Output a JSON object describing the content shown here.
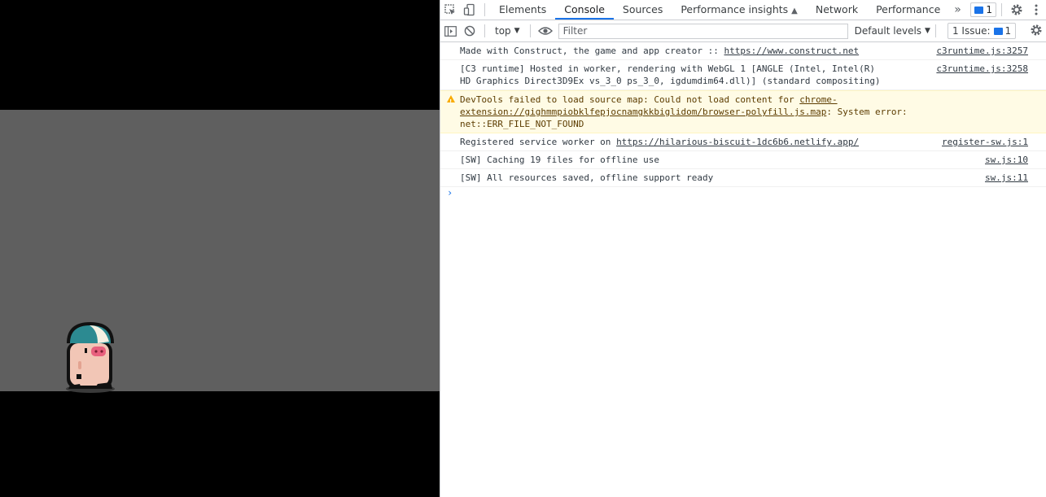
{
  "colors": {
    "canvas_bg": "#5f5f5f",
    "accent": "#1a73e8",
    "warning_bg": "#fffbe5"
  },
  "devtools": {
    "tabs": [
      "Elements",
      "Console",
      "Sources",
      "Performance insights",
      "Network",
      "Performance"
    ],
    "active_tab": "Console",
    "more_tabs_glyph": "»",
    "messages_badge": "1",
    "toolbar": {
      "context": "top",
      "filter_placeholder": "Filter",
      "levels": "Default levels",
      "issues_label": "1 Issue:",
      "issues_count": "1"
    },
    "console": [
      {
        "type": "log",
        "text": "Made with Construct, the game and app creator :: ",
        "link": "https://www.construct.net",
        "source": "c3runtime.js:3257"
      },
      {
        "type": "log",
        "text": "[C3 runtime] Hosted in worker, rendering with WebGL 1 [ANGLE (Intel, Intel(R) HD Graphics Direct3D9Ex vs_3_0 ps_3_0, igdumdim64.dll)] (standard compositing)",
        "link": "",
        "source": "c3runtime.js:3258"
      },
      {
        "type": "warning",
        "text": "DevTools failed to load source map: Could not load content for ",
        "link": "chrome-extension://gighmmpiobklfepjocnamgkkbiglidom/browser-polyfill.js.map",
        "suffix": ": System error: net::ERR_FILE_NOT_FOUND",
        "source": ""
      },
      {
        "type": "log",
        "text": "Registered service worker on ",
        "link": "https://hilarious-biscuit-1dc6b6.netlify.app/",
        "source": "register-sw.js:1"
      },
      {
        "type": "log",
        "text": "[SW] Caching 19 files for offline use",
        "link": "",
        "source": "sw.js:10"
      },
      {
        "type": "log",
        "text": "[SW] All resources saved, offline support ready",
        "link": "",
        "source": "sw.js:11"
      }
    ],
    "prompt_glyph": "›"
  }
}
